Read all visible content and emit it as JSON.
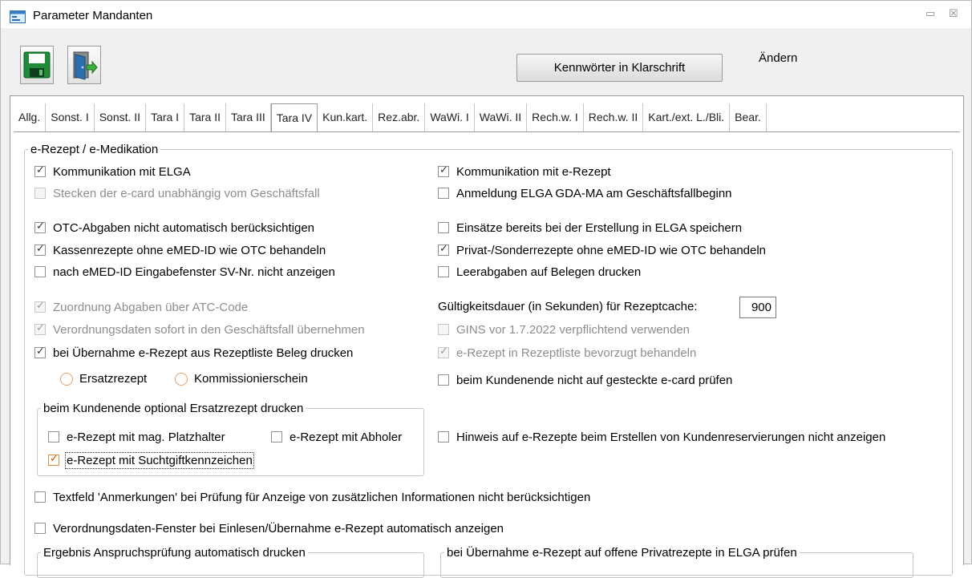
{
  "window": {
    "title": "Parameter Mandanten",
    "minimize": "▭",
    "close": "☒"
  },
  "toolbar": {
    "cleartext_button": "Kennwörter in Klarschrift",
    "mode_label": "Ändern"
  },
  "tabs": [
    {
      "label": "Allg.",
      "active": false
    },
    {
      "label": "Sonst. I",
      "active": false
    },
    {
      "label": "Sonst. II",
      "active": false
    },
    {
      "label": "Tara I",
      "active": false
    },
    {
      "label": "Tara II",
      "active": false
    },
    {
      "label": "Tara III",
      "active": false
    },
    {
      "label": "Tara IV",
      "active": true
    },
    {
      "label": "Kun.kart.",
      "active": false
    },
    {
      "label": "Rez.abr.",
      "active": false
    },
    {
      "label": "WaWi. I",
      "active": false
    },
    {
      "label": "WaWi. II",
      "active": false
    },
    {
      "label": "Rech.w. I",
      "active": false
    },
    {
      "label": "Rech.w. II",
      "active": false
    },
    {
      "label": "Kart./ext. L./Bli.",
      "active": false
    },
    {
      "label": "Bear.",
      "active": false
    }
  ],
  "erezept": {
    "legend": "e-Rezept / e-Medikation",
    "kommunikation_elga": {
      "label": "Kommunikation mit ELGA",
      "checked": true
    },
    "kommunikation_erezept": {
      "label": "Kommunikation mit e-Rezept",
      "checked": true
    },
    "stecken_ecard": {
      "label": "Stecken der e-card unabhängig vom Geschäftsfall",
      "checked": false
    },
    "anmeldung_elga": {
      "label": "Anmeldung ELGA GDA-MA am Geschäftsfallbeginn",
      "checked": false
    },
    "otc_abgaben": {
      "label": "OTC-Abgaben nicht automatisch berücksichtigen",
      "checked": true
    },
    "einsaetze": {
      "label": "Einsätze bereits bei der Erstellung in ELGA speichern",
      "checked": false
    },
    "kassenrezepte": {
      "label": "Kassenrezepte ohne eMED-ID wie OTC behandeln",
      "checked": true
    },
    "privatrezepte": {
      "label": "Privat-/Sonderrezepte ohne eMED-ID wie OTC behandeln",
      "checked": true
    },
    "svnr_fenster": {
      "label": "nach eMED-ID Eingabefenster SV-Nr. nicht anzeigen",
      "checked": false
    },
    "leerabgaben": {
      "label": "Leerabgaben auf Belegen drucken",
      "checked": false
    },
    "zuordnung_atc": {
      "label": "Zuordnung Abgaben über ATC-Code",
      "checked": true
    },
    "gueltigkeit_label": "Gültigkeitsdauer (in Sekunden) für Rezeptcache:",
    "gueltigkeit_value": "900",
    "verordnungsdaten": {
      "label": "Verordnungsdaten sofort in den Geschäftsfall übernehmen",
      "checked": true
    },
    "gins": {
      "label": "GINS vor 1.7.2022 verpflichtend verwenden",
      "checked": false
    },
    "beleg_drucken": {
      "label": "bei Übernahme e-Rezept aus Rezeptliste Beleg drucken",
      "checked": true
    },
    "bevorzugt": {
      "label": "e-Rezept in Rezeptliste bevorzugt behandeln",
      "checked": true
    },
    "radio_ersatz": "Ersatzrezept",
    "radio_kommission": "Kommissionierschein",
    "ecard_pruefen": {
      "label": "beim Kundenende nicht auf gesteckte e-card prüfen",
      "checked": false
    },
    "hinweis": {
      "label": "Hinweis auf e-Rezepte beim Erstellen von Kundenreservierungen nicht anzeigen",
      "checked": false
    },
    "anmerkungen": {
      "label": "Textfeld 'Anmerkungen' bei Prüfung für Anzeige von zusätzlichen Informationen nicht berücksichtigen",
      "checked": false
    },
    "verordnungsfenster": {
      "label": "Verordnungsdaten-Fenster bei Einlesen/Übernahme e-Rezept automatisch anzeigen",
      "checked": false
    }
  },
  "kundenende": {
    "legend": "beim Kundenende optional Ersatzrezept drucken",
    "platzhalter": {
      "label": "e-Rezept mit mag. Platzhalter",
      "checked": false
    },
    "abholer": {
      "label": "e-Rezept mit Abholer",
      "checked": false
    },
    "suchtgift": {
      "label": "e-Rezept mit Suchtgiftkennzeichen",
      "checked": true
    }
  },
  "bottom": {
    "anspruch_legend": "Ergebnis Anspruchsprüfung automatisch drucken",
    "privat_legend": "bei Übernahme e-Rezept auf offene Privatrezepte in ELGA prüfen"
  }
}
